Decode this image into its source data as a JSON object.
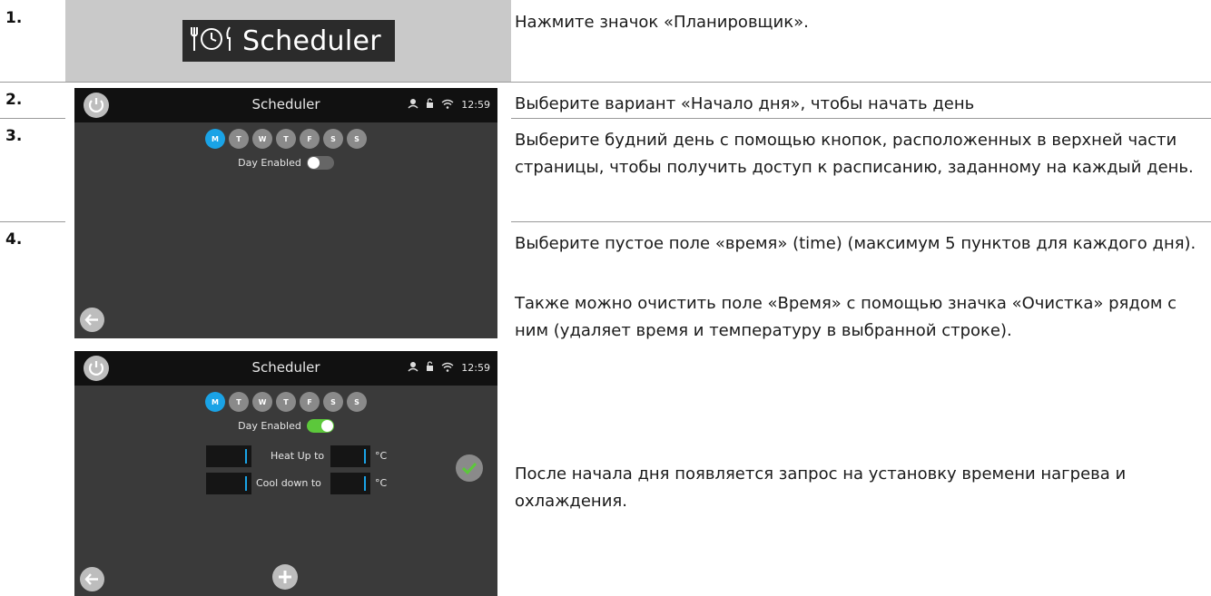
{
  "steps": [
    {
      "num": "1.",
      "text": "Нажмите значок «Планировщик»."
    },
    {
      "num": "2.",
      "text": "Выберите вариант «Начало дня», чтобы начать день"
    },
    {
      "num": "3.",
      "text": "Выберите будний день с помощью кнопок, расположенных в верхней части страницы, чтобы получить доступ к расписанию, заданному на каждый день."
    },
    {
      "num": "4.",
      "text": "Выберите пустое поле «время» (time) (максимум 5 пунктов для каждого дня).",
      "text2": "Также можно очистить поле «Время» с помощью значка «Очистка» рядом с ним (удаляет время и температуру в выбранной строке).",
      "text3": "После начала дня появляется запрос на установку времени нагрева и охлаждения."
    }
  ],
  "scheduler_button": {
    "label": "Scheduler",
    "icon": "fork-clock-knife-icon"
  },
  "screen": {
    "title": "Scheduler",
    "time": "12:59",
    "days": [
      "M",
      "T",
      "W",
      "T",
      "F",
      "S",
      "S"
    ],
    "active_day": "M",
    "day_enabled_label": "Day Enabled",
    "day_enabled_screen1": false,
    "day_enabled_screen2": true,
    "heat_label": "Heat Up to",
    "cool_label": "Cool down to",
    "unit": "°C"
  },
  "colors": {
    "accent_blue": "#1aa3e6",
    "toggle_green": "#5cc83b",
    "screen_bg": "#3a3a3a",
    "bar_bg": "#111111"
  }
}
